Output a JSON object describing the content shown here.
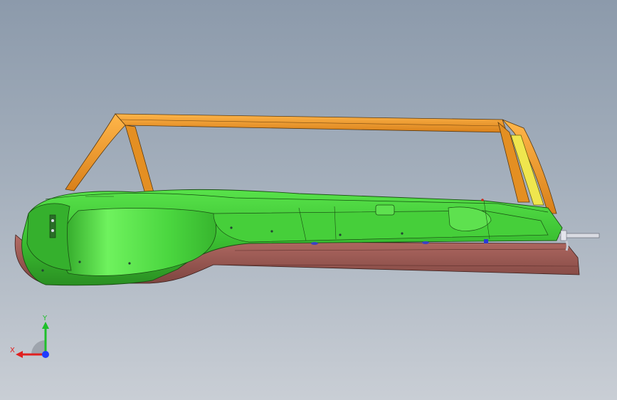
{
  "viewport": {
    "background_top": "#8c9aab",
    "background_bottom": "#c9ced5"
  },
  "model": {
    "frame_color": "#f09a2a",
    "body_color": "#3fc435",
    "skirt_color": "#9a5b55",
    "pillar_color": "#e9e04a"
  },
  "triad": {
    "x_label": "X",
    "y_label": "Y",
    "x_color": "#e02020",
    "y_color": "#1fbf2a",
    "z_color": "#1f3cff"
  }
}
